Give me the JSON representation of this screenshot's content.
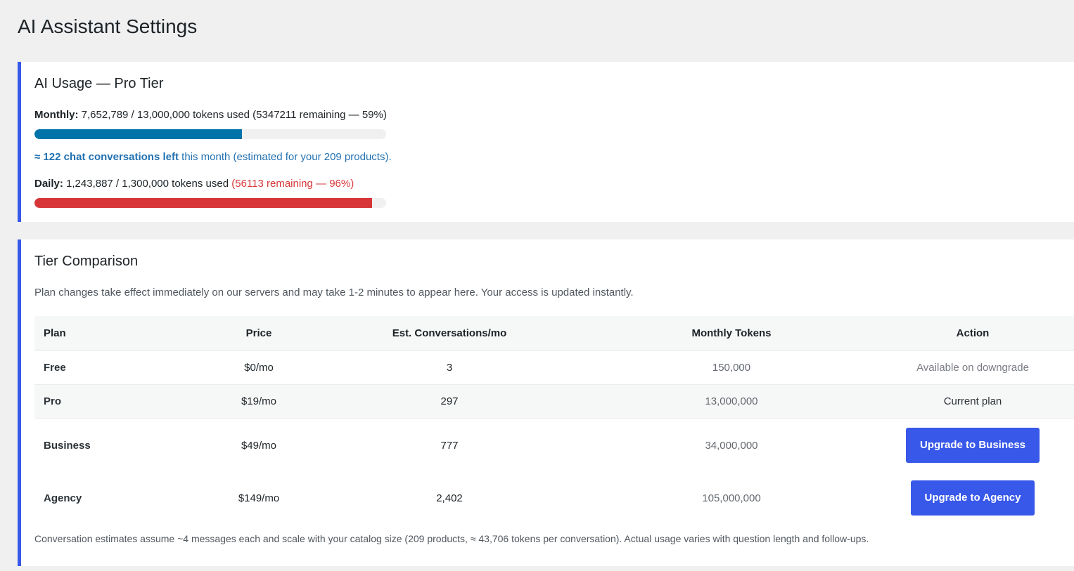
{
  "page_title": "AI Assistant Settings",
  "usage": {
    "title": "AI Usage — Pro Tier",
    "monthly": {
      "label": "Monthly:",
      "text": "7,652,789 / 13,000,000 tokens used (5347211 remaining — 59%)",
      "fill_fraction": 0.59,
      "color": "#0073aa"
    },
    "estimate": {
      "bold": "≈ 122 chat conversations left",
      "rest": " this month (estimated for your 209 products)."
    },
    "daily": {
      "label": "Daily:",
      "text": "1,243,887 / 1,300,000 tokens used",
      "warn_text": "(56113 remaining — 96%)",
      "fill_fraction": 0.96,
      "color": "#d63638"
    }
  },
  "tiers": {
    "title": "Tier Comparison",
    "description": "Plan changes take effect immediately on our servers and may take 1-2 minutes to appear here. Your access is updated instantly.",
    "headers": {
      "plan": "Plan",
      "price": "Price",
      "conversations": "Est. Conversations/mo",
      "tokens": "Monthly Tokens",
      "action": "Action"
    },
    "rows": [
      {
        "plan": "Free",
        "price": "$0/mo",
        "conversations": "3",
        "tokens": "150,000",
        "action": "Available on downgrade"
      },
      {
        "plan": "Pro",
        "price": "$19/mo",
        "conversations": "297",
        "tokens": "13,000,000",
        "action": "Current plan"
      },
      {
        "plan": "Business",
        "price": "$49/mo",
        "conversations": "777",
        "tokens": "34,000,000",
        "action": "Upgrade to Business"
      },
      {
        "plan": "Agency",
        "price": "$149/mo",
        "conversations": "2,402",
        "tokens": "105,000,000",
        "action": "Upgrade to Agency"
      }
    ],
    "footnote": "Conversation estimates assume ~4 messages each and scale with your catalog size (209 products, ≈ 43,706 tokens per conversation). Actual usage varies with question length and follow-ups."
  },
  "colors": {
    "accent": "#3858e9",
    "monthly_bar": "#0073aa",
    "daily_bar": "#d63638",
    "estimate_text": "#2271b1"
  }
}
